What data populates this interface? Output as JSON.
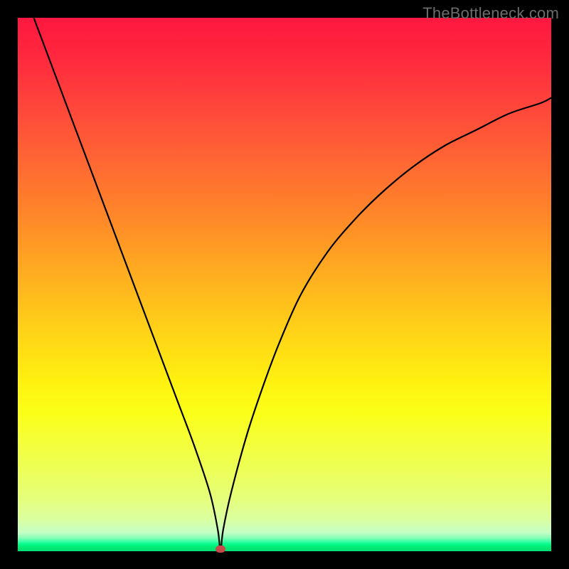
{
  "watermark": "TheBottleneck.com",
  "colors": {
    "frame": "#000000",
    "curve": "#000000",
    "gradient_top": "#ff173f",
    "gradient_bottom": "#00e070",
    "minpoint": "#c74a4a"
  },
  "chart_data": {
    "type": "line",
    "title": "",
    "xlabel": "",
    "ylabel": "",
    "xlim": [
      0,
      100
    ],
    "ylim": [
      0,
      100
    ],
    "annotations": [],
    "minpoint": {
      "x": 38,
      "y": 0
    },
    "series": [
      {
        "name": "bottleneck-curve",
        "x": [
          3,
          6,
          9,
          12,
          15,
          18,
          21,
          24,
          27,
          30,
          33,
          36,
          37.5,
          38,
          38.5,
          40,
          43,
          46,
          49,
          53,
          58,
          63,
          68,
          74,
          80,
          86,
          92,
          98,
          100
        ],
        "y": [
          100,
          92,
          84,
          76,
          68,
          60,
          52,
          44,
          36,
          28,
          20,
          11,
          4,
          0,
          4,
          11,
          22,
          31,
          39,
          48,
          56,
          62,
          67,
          72,
          76,
          79,
          82,
          84,
          85
        ]
      }
    ]
  }
}
